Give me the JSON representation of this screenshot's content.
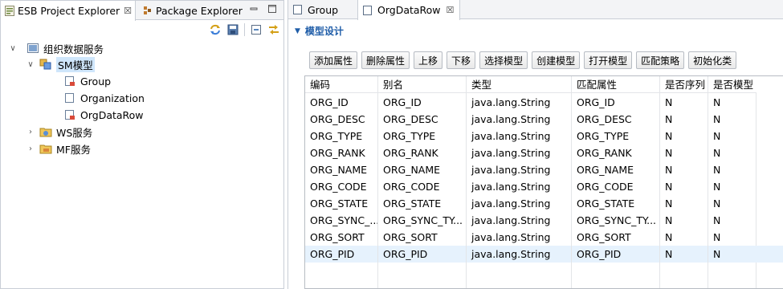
{
  "left_view": {
    "tabs": [
      {
        "label": "ESB Project Explorer",
        "close": "☒"
      },
      {
        "label": "Package Explorer"
      }
    ],
    "window_buttons": [
      "minimize-icon",
      "maximize-icon"
    ],
    "toolbar_icons": [
      "sync-icon",
      "save-icon",
      "collapse-all-icon",
      "link-with-editor-icon"
    ],
    "tree": [
      {
        "label": "组织数据服务",
        "expanded": true,
        "icon": "service-folder-icon"
      },
      {
        "label": "SM模型",
        "expanded": true,
        "icon": "sm-model-icon",
        "selected": true
      },
      {
        "label": "Group",
        "icon": "data-object-red-icon"
      },
      {
        "label": "Organization",
        "icon": "data-object-empty-icon"
      },
      {
        "label": "OrgDataRow",
        "icon": "data-object-red-icon"
      },
      {
        "label": "WS服务",
        "expanded": false,
        "icon": "ws-service-icon"
      },
      {
        "label": "MF服务",
        "expanded": false,
        "icon": "mf-service-icon"
      }
    ]
  },
  "editor": {
    "tabs": [
      {
        "label": "Group"
      },
      {
        "label": "OrgDataRow",
        "close": "☒",
        "active": true
      }
    ],
    "section_title": "模型设计",
    "buttons": [
      "添加属性",
      "删除属性",
      "上移",
      "下移",
      "选择模型",
      "创建模型",
      "打开模型",
      "匹配策略",
      "初始化类"
    ],
    "table": {
      "headers": [
        "编码",
        "别名",
        "类型",
        "匹配属性",
        "是否序列",
        "是否模型"
      ],
      "rows": [
        [
          "ORG_ID",
          "ORG_ID",
          "java.lang.String",
          "ORG_ID",
          "N",
          "N"
        ],
        [
          "ORG_DESC",
          "ORG_DESC",
          "java.lang.String",
          "ORG_DESC",
          "N",
          "N"
        ],
        [
          "ORG_TYPE",
          "ORG_TYPE",
          "java.lang.String",
          "ORG_TYPE",
          "N",
          "N"
        ],
        [
          "ORG_RANK",
          "ORG_RANK",
          "java.lang.String",
          "ORG_RANK",
          "N",
          "N"
        ],
        [
          "ORG_NAME",
          "ORG_NAME",
          "java.lang.String",
          "ORG_NAME",
          "N",
          "N"
        ],
        [
          "ORG_CODE",
          "ORG_CODE",
          "java.lang.String",
          "ORG_CODE",
          "N",
          "N"
        ],
        [
          "ORG_STATE",
          "ORG_STATE",
          "java.lang.String",
          "ORG_STATE",
          "N",
          "N"
        ],
        [
          "ORG_SYNC_...",
          "ORG_SYNC_TY...",
          "java.lang.String",
          "ORG_SYNC_TY...",
          "N",
          "N"
        ],
        [
          "ORG_SORT",
          "ORG_SORT",
          "java.lang.String",
          "ORG_SORT",
          "N",
          "N"
        ],
        [
          "ORG_PID",
          "ORG_PID",
          "java.lang.String",
          "ORG_PID",
          "N",
          "N"
        ]
      ],
      "selected_row": 9
    }
  },
  "colors": {
    "section_title": "#1f5da8",
    "selection": "#cfe6fb",
    "row_selection": "#e6f2fd",
    "border": "#c9ced6"
  }
}
